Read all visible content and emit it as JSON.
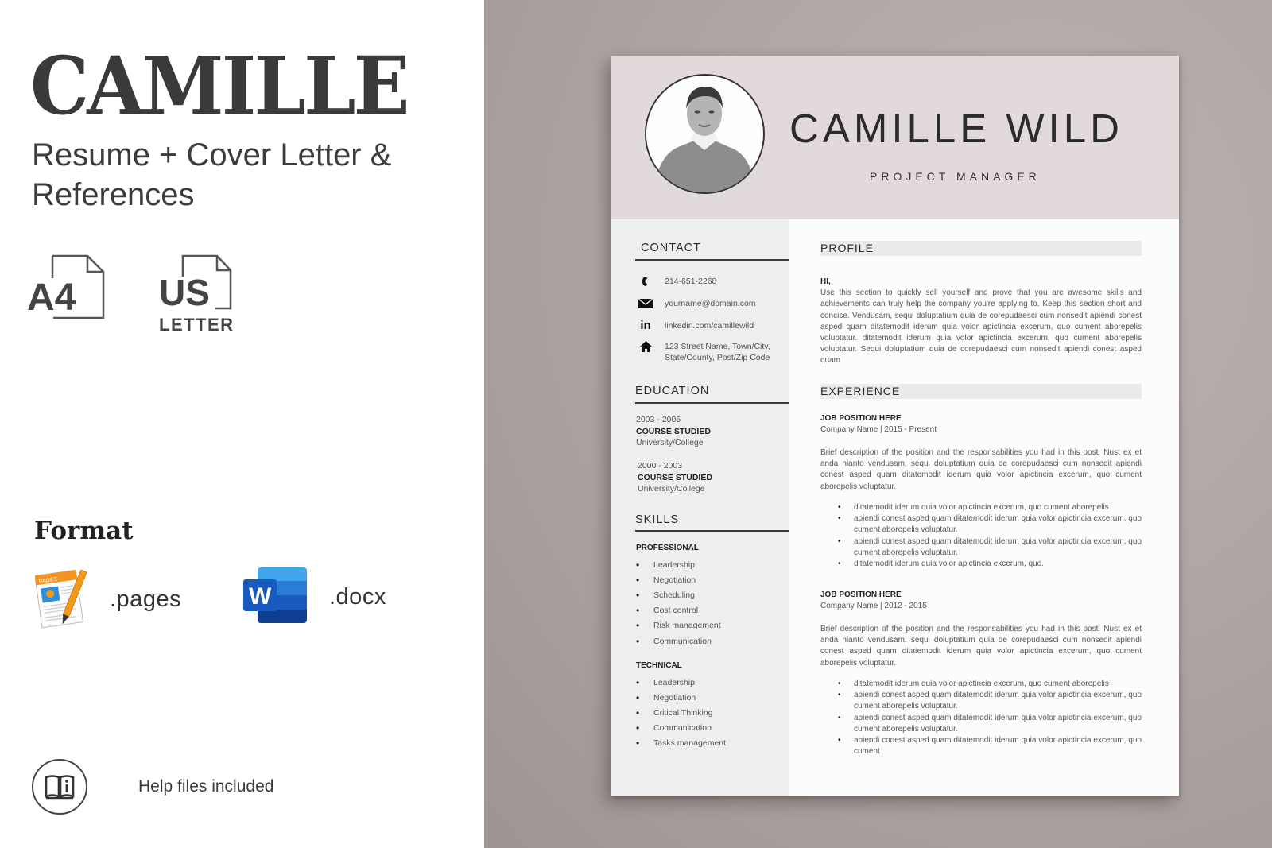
{
  "promo": {
    "title": "CAMILLE",
    "subtitle_line1": "Resume + Cover Letter &",
    "subtitle_line2": "References",
    "sizes": [
      {
        "icon": "a4-document-icon",
        "label": "A4"
      },
      {
        "icon": "us-letter-document-icon",
        "label": "US",
        "sublabel": "LETTER"
      }
    ],
    "format_heading": "Format",
    "formats": [
      {
        "icon": "pages-app-icon",
        "label": ".pages"
      },
      {
        "icon": "word-app-icon",
        "label": ".docx"
      }
    ],
    "help": {
      "icon": "book-info-icon",
      "label": "Help files included"
    }
  },
  "resume": {
    "name": "CAMILLE  WILD",
    "job_title": "PROJECT MANAGER",
    "header_color": "#e1d9da",
    "contact": {
      "heading": "CONTACT",
      "items": [
        {
          "icon": "phone-icon",
          "text": "214-651-2268"
        },
        {
          "icon": "envelope-icon",
          "text": "yourname@domain.com"
        },
        {
          "icon": "linkedin-icon",
          "text": "linkedin.com/camillewild"
        },
        {
          "icon": "home-icon",
          "text": "123 Street Name, Town/City,",
          "text2": "State/County, Post/Zip Code"
        }
      ]
    },
    "education": {
      "heading": "EDUCATION",
      "items": [
        {
          "years": "2003 - 2005",
          "course": "COURSE STUDIED",
          "school": "University/College"
        },
        {
          "years": "2000 - 2003",
          "course": "COURSE STUDIED",
          "school": "University/College"
        }
      ]
    },
    "skills": {
      "heading": "SKILLS",
      "groups": [
        {
          "title": "PROFESSIONAL",
          "items": [
            "Leadership",
            "Negotiation",
            "Scheduling",
            "Cost control",
            "Risk management",
            "Communication"
          ]
        },
        {
          "title": "TECHNICAL",
          "items": [
            "Leadership",
            "Negotiation",
            "Critical Thinking",
            "Communication",
            "Tasks management"
          ]
        }
      ]
    },
    "profile": {
      "heading": "PROFILE",
      "greeting": "HI,",
      "text": "Use this section to quickly sell yourself and prove that you are awesome skills and achievements can truly help the company you're applying to. Keep this section short and concise. Vendusam, sequi doluptatium quia de corepudaesci cum nonsedit apiendi conest asped quam ditatemodit iderum quia volor apictincia excerum, quo cument aborepelis voluptatur. ditatemodit iderum quia volor apictincia excerum, quo cument aborepelis voluptatur.  Sequi doluptatium quia de corepudaesci cum nonsedit apiendi conest asped quam"
    },
    "experience": {
      "heading": "EXPERIENCE",
      "jobs": [
        {
          "title": "JOB POSITION HERE",
          "company": "Company Name | 2015 - Present",
          "description": "Brief description of the position and the responsabilities you had in this post. Nust ex et anda nianto vendusam, sequi doluptatium quia de corepudaesci cum nonsedit apiendi conest asped quam ditatemodit iderum quia volor apictincia excerum, quo cument aborepelis voluptatur.",
          "bullets": [
            "ditatemodit iderum quia volor apictincia excerum, quo cument aborepelis",
            "apiendi conest asped quam ditatemodit iderum quia volor apictincia excerum, quo cument aborepelis voluptatur.",
            "apiendi conest asped quam ditatemodit iderum quia volor apictincia excerum, quo cument aborepelis voluptatur.",
            "ditatemodit iderum quia volor apictincia excerum, quo."
          ]
        },
        {
          "title": "JOB POSITION HERE",
          "company": "Company Name | 2012 - 2015",
          "description": "Brief description of the position and the responsabilities you had in this post. Nust ex et anda nianto vendusam, sequi doluptatium quia de corepudaesci cum nonsedit apiendi conest asped quam ditatemodit iderum quia volor apictincia excerum, quo cument aborepelis voluptatur.",
          "bullets": [
            "ditatemodit iderum quia volor apictincia excerum, quo cument aborepelis",
            "apiendi conest asped quam ditatemodit iderum quia volor apictincia excerum, quo cument aborepelis voluptatur.",
            "apiendi conest asped quam ditatemodit iderum quia volor apictincia excerum, quo cument aborepelis voluptatur.",
            "apiendi conest asped quam ditatemodit iderum quia volor apictincia excerum, quo cument"
          ]
        }
      ]
    }
  }
}
